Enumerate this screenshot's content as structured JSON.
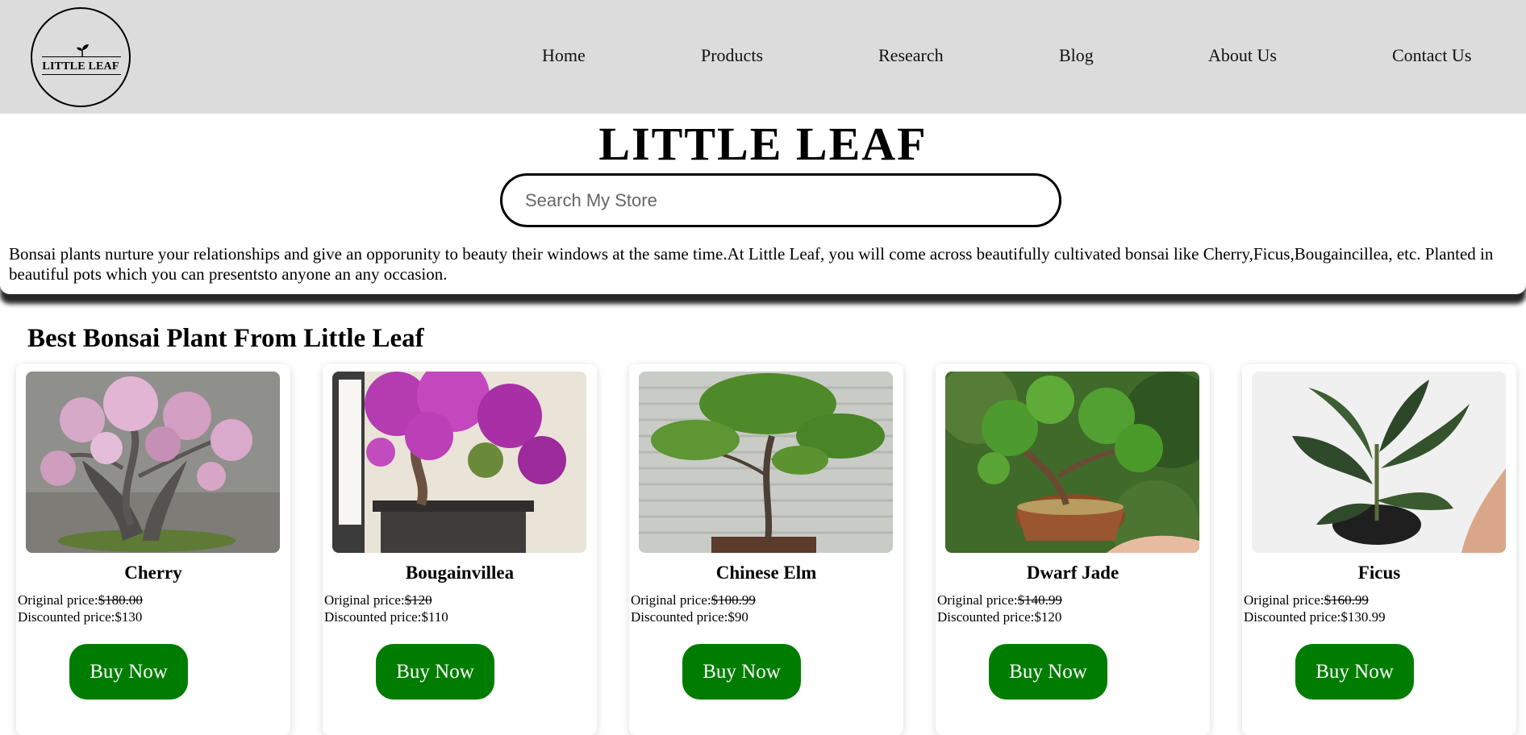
{
  "navbar": {
    "logo_text": "LITTLE LEAF",
    "items": [
      "Home",
      "Products",
      "Research",
      "Blog",
      "About Us",
      "Contact Us"
    ]
  },
  "header": {
    "title": "LITTLE LEAF",
    "search_placeholder": "Search My Store"
  },
  "intro": {
    "text": "Bonsai plants nurture your relationships and give an opporunity to beauty their windows at the same time.At Little Leaf, you will come across beautifully cultivated bonsai like Cherry,Ficus,Bougaincillea, etc. Planted in beautiful pots which you can presentsto anyone an any occasion."
  },
  "products": {
    "heading": "Best Bonsai Plant From Little Leaf",
    "original_label": "Original price:",
    "discounted_label": "Discounted price:",
    "buy_label": "Buy Now",
    "items": [
      {
        "name": "Cherry",
        "original": "$180.00",
        "discounted": "$130"
      },
      {
        "name": "Bougainvillea",
        "original": "$120",
        "discounted": "$110"
      },
      {
        "name": "Chinese Elm",
        "original": "$100.99",
        "discounted": "$90"
      },
      {
        "name": "Dwarf Jade",
        "original": "$140.99",
        "discounted": "$120"
      },
      {
        "name": "Ficus",
        "original": "$160.99",
        "discounted": "$130.99"
      }
    ]
  },
  "colors": {
    "navbar_bg": "#dcdcdc",
    "buy_button": "#007d00"
  }
}
